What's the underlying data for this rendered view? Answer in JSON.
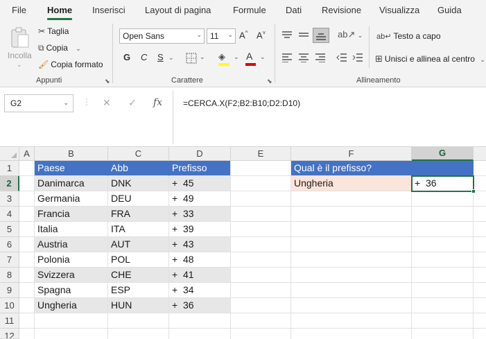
{
  "tabs": [
    "File",
    "Home",
    "Inserisci",
    "Layout di pagina",
    "Formule",
    "Dati",
    "Revisione",
    "Visualizza",
    "Guida"
  ],
  "active_tab": "Home",
  "clipboard": {
    "paste_label": "Incolla",
    "cut_label": "Taglia",
    "copy_label": "Copia",
    "format_painter_label": "Copia formato",
    "group_label": "Appunti"
  },
  "font": {
    "family_value": "Open Sans",
    "size_value": "11",
    "bold": "G",
    "italic": "C",
    "underline": "S",
    "font_color_glyph": "A",
    "grow_glyph": "A^",
    "shrink_glyph": "A˅",
    "group_label": "Carattere",
    "fill_color": "#ffff00",
    "font_color": "#e00000"
  },
  "alignment": {
    "wrap_label": "Testo a capo",
    "merge_label": "Unisci e allinea al centro",
    "group_label": "Allineamento"
  },
  "formula_bar": {
    "name_box": "G2",
    "formula": "=CERCA.X(F2;B2:B10;D2:D10)"
  },
  "columns": [
    "A",
    "B",
    "C",
    "D",
    "E",
    "F",
    "G"
  ],
  "rows": [
    "1",
    "2",
    "3",
    "4",
    "5",
    "6",
    "7",
    "8",
    "9",
    "10",
    "11",
    "12"
  ],
  "table": {
    "headers": [
      "Paese",
      "Abb",
      "Prefisso"
    ],
    "rows": [
      [
        "Danimarca",
        "DNK",
        "+  45"
      ],
      [
        "Germania",
        "DEU",
        "+  49"
      ],
      [
        "Francia",
        "FRA",
        "+  33"
      ],
      [
        "Italia",
        "ITA",
        "+  39"
      ],
      [
        "Austria",
        "AUT",
        "+  43"
      ],
      [
        "Polonia",
        "POL",
        "+  48"
      ],
      [
        "Svizzera",
        "CHE",
        "+  41"
      ],
      [
        "Spagna",
        "ESP",
        "+  34"
      ],
      [
        "Ungheria",
        "HUN",
        "+  36"
      ]
    ]
  },
  "lookup": {
    "question": "Qual è il prefisso?",
    "input": "Ungheria",
    "result": "+  36"
  },
  "selected_cell": "G2",
  "colors": {
    "header_blue": "#4472c4",
    "band_gray": "#e7e7e7",
    "input_peach": "#fbe4d9",
    "excel_green": "#217346"
  }
}
